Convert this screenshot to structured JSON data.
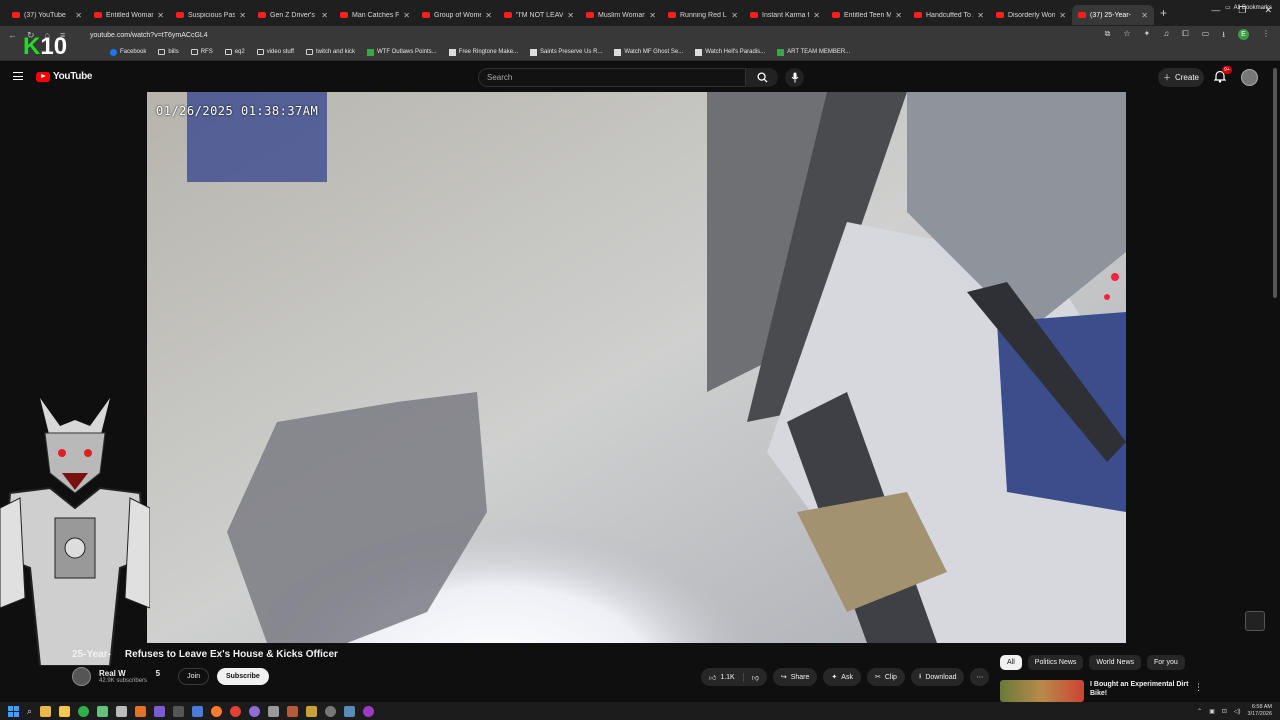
{
  "browser": {
    "tabs": [
      {
        "label": "(37) YouTube"
      },
      {
        "label": "Entitled Woman I"
      },
      {
        "label": "Suspicious Passe"
      },
      {
        "label": "Gen Z Driver's Po"
      },
      {
        "label": "Man Catches Flor"
      },
      {
        "label": "Group of Women"
      },
      {
        "label": "\"I'M NOT LEAVIN"
      },
      {
        "label": "Muslim Woman A"
      },
      {
        "label": "Running Red Ligh"
      },
      {
        "label": "Instant Karma fo"
      },
      {
        "label": "Entitled Teen Me"
      },
      {
        "label": "Handcuffed To A"
      },
      {
        "label": "Disorderly Wome"
      },
      {
        "label": "(37) 25-Year-"
      }
    ],
    "active_tab": 13,
    "url": "youtube.com/watch?v=tT6ymACcGL4",
    "bookmarks": [
      {
        "label": "Facebook",
        "icon": "facebook-icon"
      },
      {
        "label": "bills",
        "icon": "folder-icon"
      },
      {
        "label": "RFS",
        "icon": "folder-icon"
      },
      {
        "label": "eq2",
        "icon": "folder-icon"
      },
      {
        "label": "video stuff",
        "icon": "folder-icon"
      },
      {
        "label": "twitch and kick",
        "icon": "folder-icon"
      },
      {
        "label": "WTF Outlaws Points...",
        "icon": "plus-icon"
      },
      {
        "label": "Free Ringtone Make...",
        "icon": "page-icon"
      },
      {
        "label": "Saints Preserve Us R...",
        "icon": "page-icon"
      },
      {
        "label": "Watch MF Ghost Se...",
        "icon": "page-icon"
      },
      {
        "label": "Watch Hell's Paradis...",
        "icon": "page-icon"
      },
      {
        "label": "ART TEAM MEMBER...",
        "icon": "plus-icon"
      }
    ],
    "all_bookmarks": "All Bookmarks",
    "profile_letter": "E"
  },
  "overlay": {
    "k": "K",
    "ten": "10"
  },
  "youtube": {
    "logo": "YouTube",
    "search_placeholder": "Search",
    "create": "Create",
    "notif_count": "9+"
  },
  "video": {
    "timestamp": "01/26/2025 01:38:37AM",
    "title_prefix": "25-Year-",
    "title_rest": "Refuses to Leave Ex's House & Kicks Officer",
    "channel_name": "Real W",
    "channel_suffix": "5",
    "subscribers": "42.9K subscribers",
    "join": "Join",
    "subscribe": "Subscribe",
    "likes": "1.1K",
    "share": "Share",
    "ask": "Ask",
    "clip": "Clip",
    "download": "Download"
  },
  "sidebar": {
    "chips": [
      "All",
      "Politics News",
      "World News",
      "For you"
    ],
    "rec_title": "I Bought an Experimental Dirt Bike!"
  },
  "taskbar": {
    "time": "6:58 AM",
    "date": "3/17/2026"
  },
  "colors": {
    "yt_red": "#ff0000",
    "bg": "#0f0f0f",
    "k_green": "#22dd22"
  }
}
